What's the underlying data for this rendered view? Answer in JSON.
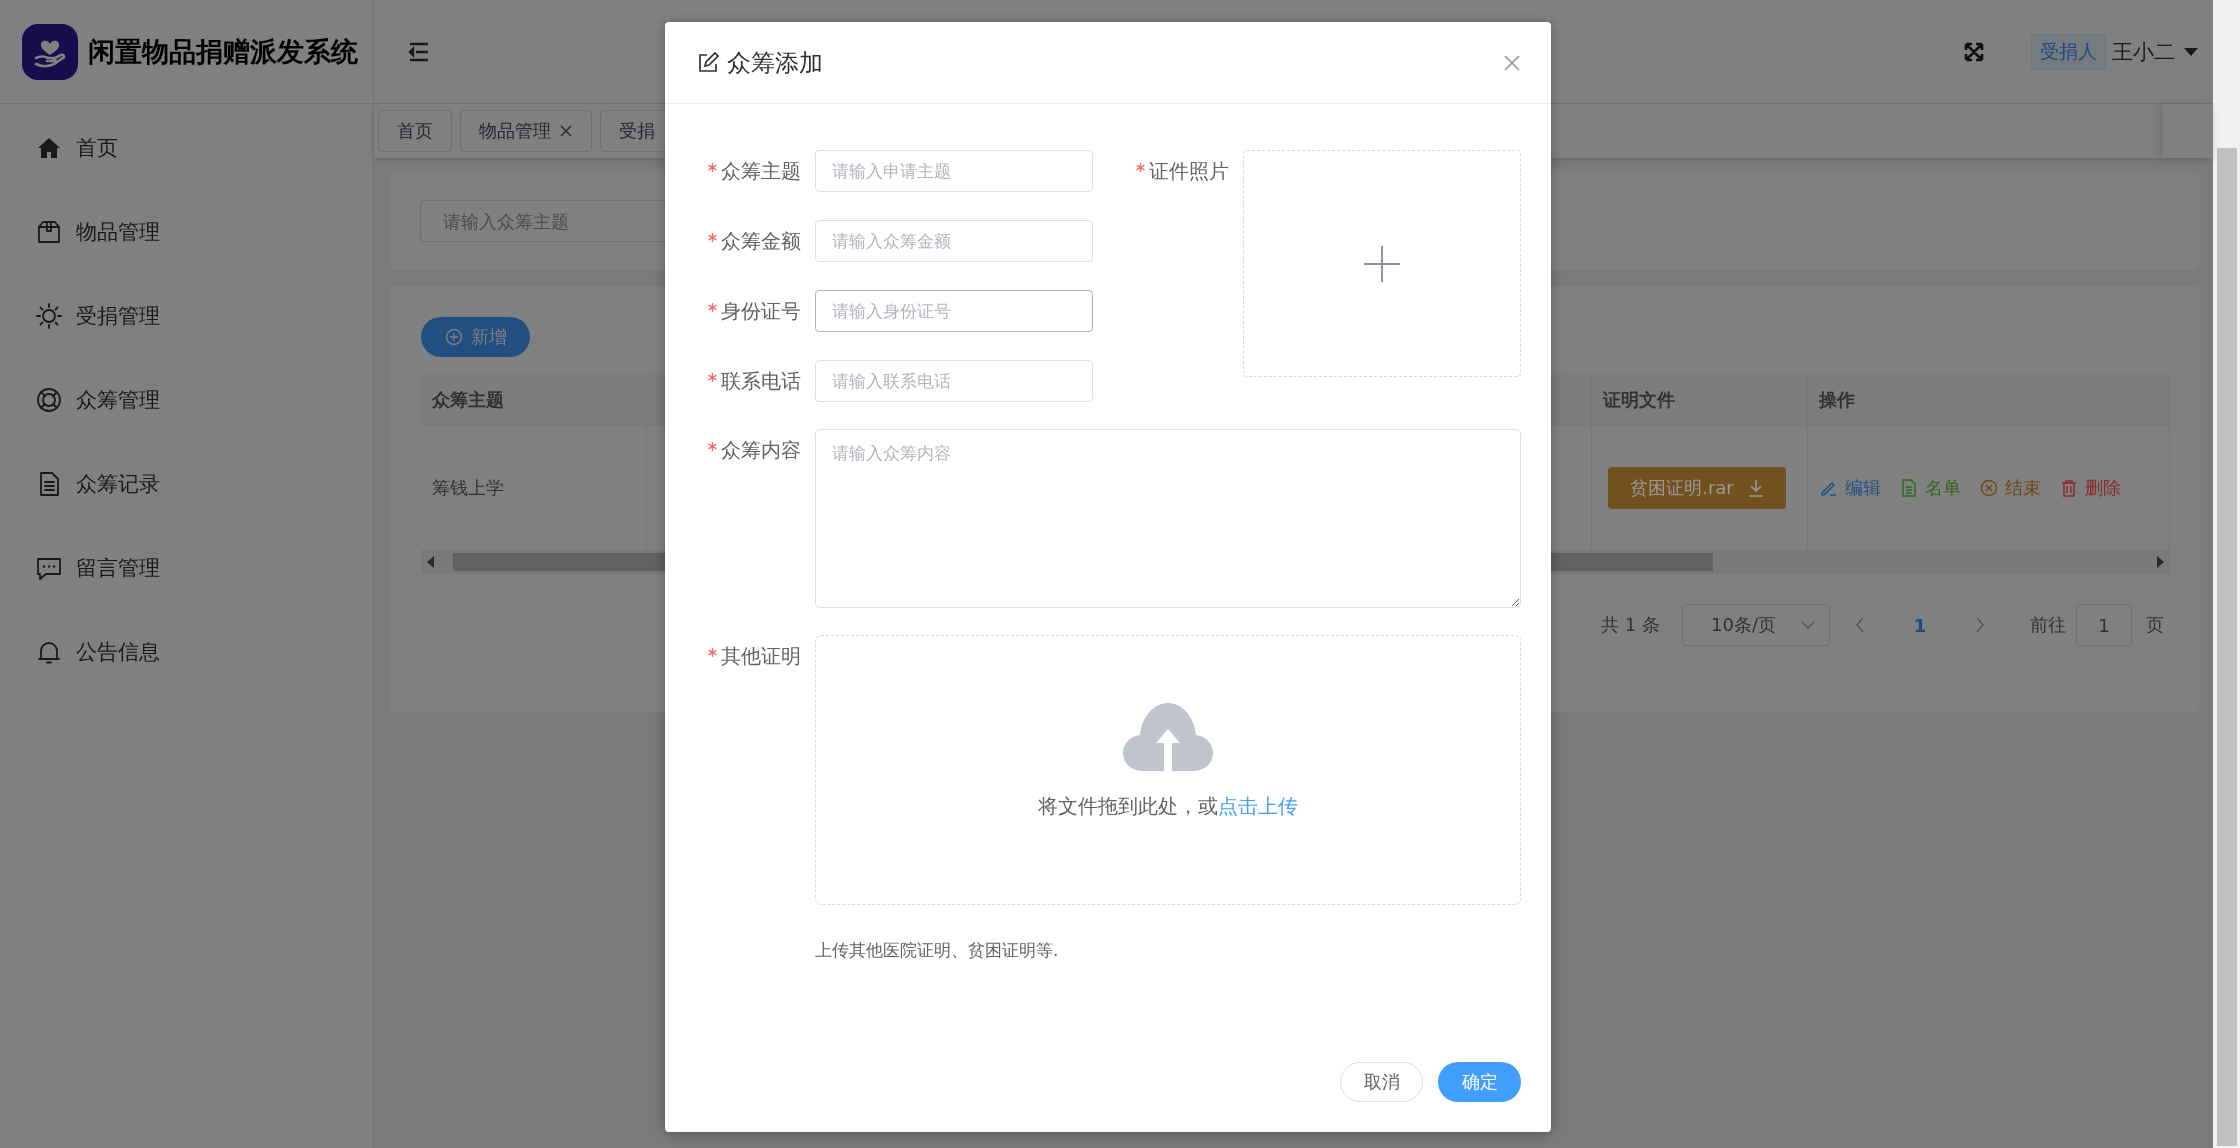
{
  "header": {
    "app_title": "闲置物品捐赠派发系统",
    "role_tag": "受捐人",
    "user_name": "王小二"
  },
  "sidebar": {
    "items": [
      {
        "label": "首页"
      },
      {
        "label": "物品管理"
      },
      {
        "label": "受捐管理"
      },
      {
        "label": "众筹管理"
      },
      {
        "label": "众筹记录"
      },
      {
        "label": "留言管理"
      },
      {
        "label": "公告信息"
      }
    ]
  },
  "tabs": [
    {
      "label": "首页",
      "closable": false
    },
    {
      "label": "物品管理",
      "closable": true
    },
    {
      "label": "受捐",
      "closable": false
    }
  ],
  "search": {
    "placeholder": "请输入众筹主题"
  },
  "table": {
    "add_button": "新增",
    "columns": [
      "众筹主题",
      "证明文件",
      "操作"
    ],
    "rows": [
      {
        "subject": "筹钱上学",
        "file": "贫困证明.rar",
        "actions": [
          {
            "label": "编辑",
            "color": "#1f4f85"
          },
          {
            "label": "名单",
            "color": "#2f6a1a"
          },
          {
            "label": "结束",
            "color": "#6e4a10"
          },
          {
            "label": "删除",
            "color": "#8a2a2a"
          }
        ]
      }
    ]
  },
  "pagination": {
    "total": "共 1 条",
    "page_size": "10条/页",
    "current_page": "1",
    "goto_label": "前往",
    "goto_value": "1",
    "page_unit": "页"
  },
  "dialog": {
    "title": "众筹添加",
    "fields": [
      {
        "label": "众筹主题",
        "required": true,
        "placeholder": "请输入申请主题",
        "focused": false
      },
      {
        "label": "众筹金额",
        "required": true,
        "placeholder": "请输入众筹金额",
        "focused": false
      },
      {
        "label": "身份证号",
        "required": true,
        "placeholder": "请输入身份证号",
        "focused": true
      },
      {
        "label": "联系电话",
        "required": true,
        "placeholder": "请输入联系电话",
        "focused": false
      }
    ],
    "photo": {
      "label": "证件照片",
      "required": true
    },
    "content": {
      "label": "众筹内容",
      "required": true,
      "placeholder": "请输入众筹内容"
    },
    "other_proof": {
      "label": "其他证明",
      "required": true,
      "drop_text": "将文件拖到此处，或",
      "upload_link": "点击上传",
      "hint": "上传其他医院证明、贫困证明等."
    },
    "cancel_button": "取消",
    "confirm_button": "确定"
  }
}
